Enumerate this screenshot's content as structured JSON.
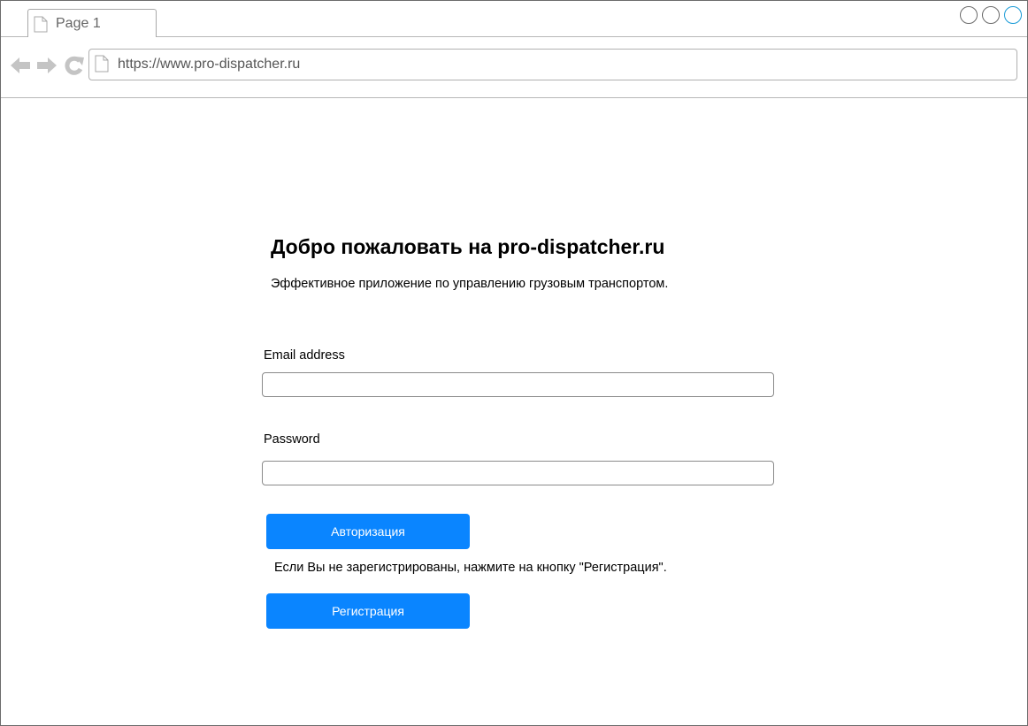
{
  "browser": {
    "tab_label": "Page 1",
    "url": "https://www.pro-dispatcher.ru",
    "window_buttons": [
      "minimize",
      "maximize",
      "close"
    ]
  },
  "colors": {
    "primary_button": "#0a85ff",
    "close_button_accent": "#1a9bd7"
  },
  "welcome": {
    "title": "Добро пожаловать на pro-dispatcher.ru",
    "subtitle": "Эффективное приложение по управлению грузовым транспортом."
  },
  "login_form": {
    "email_label": "Email address",
    "email_value": "",
    "password_label": "Password",
    "password_value": "",
    "login_button_label": "Авторизация",
    "register_hint": "Если Вы не зарегистрированы, нажмите на кнопку \"Регистрация\".",
    "register_button_label": "Регистрация"
  },
  "icons": [
    "page-icon",
    "back-arrow-icon",
    "forward-arrow-icon",
    "reload-icon"
  ]
}
